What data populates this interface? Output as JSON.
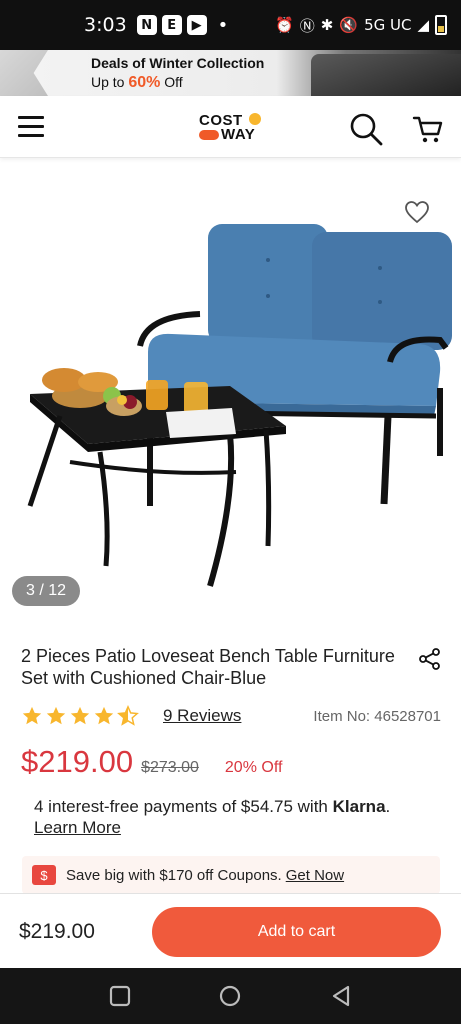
{
  "status_bar": {
    "time": "3:03",
    "network": "5G UC"
  },
  "promo_banner": {
    "title": "Deals of Winter Collection",
    "sub_prefix": "Up to ",
    "sub_highlight": "60%",
    "sub_suffix": " Off"
  },
  "header": {
    "logo_top": "COST",
    "logo_bottom": "WAY",
    "icons": [
      "menu-icon",
      "search-icon",
      "cart-icon"
    ]
  },
  "gallery": {
    "counter": "3 / 12"
  },
  "product": {
    "title": "2 Pieces Patio Loveseat Bench Table Furniture Set with Cushioned Chair-Blue",
    "rating": 4.5,
    "reviews_label": "9 Reviews",
    "item_no": "Item No: 46528701",
    "price": "$219.00",
    "old_price": "$273.00",
    "discount": "20% Off"
  },
  "klarna": {
    "text": "4 interest-free payments of $54.75 with ",
    "brand": "Klarna",
    "period": ".",
    "learn_more": "Learn More"
  },
  "coupon": {
    "text": "Save big with $170 off Coupons.",
    "link": "Get Now"
  },
  "bottom_bar": {
    "price": "$219.00",
    "add_to_cart": "Add to cart"
  },
  "colors": {
    "accent": "#f05a3c",
    "price_red": "#d9373f",
    "star": "#f8b62d",
    "sofa_blue": "#4a7fb0"
  }
}
